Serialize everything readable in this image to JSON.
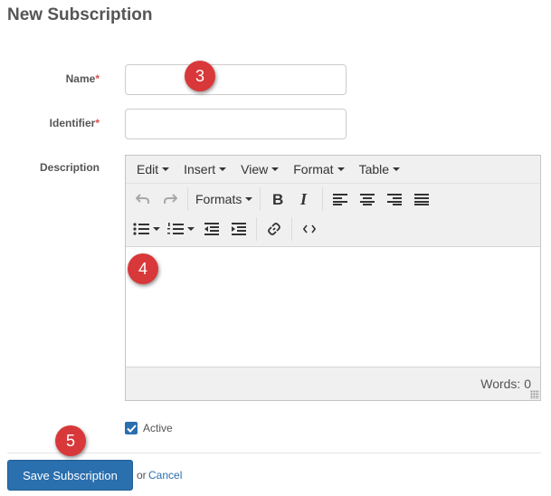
{
  "page": {
    "title": "New Subscription"
  },
  "form": {
    "name": {
      "label": "Name",
      "required_mark": "*",
      "value": ""
    },
    "identifier": {
      "label": "Identifier",
      "required_mark": "*",
      "value": ""
    },
    "description": {
      "label": "Description"
    },
    "active": {
      "label": "Active",
      "checked": true
    }
  },
  "editor": {
    "menus": [
      "Edit",
      "Insert",
      "View",
      "Format",
      "Table"
    ],
    "formats_label": "Formats",
    "status": "Words: 0"
  },
  "badges": [
    "3",
    "4",
    "5"
  ],
  "actions": {
    "save_label": "Save Subscription",
    "or_text": "or",
    "cancel_label": "Cancel"
  },
  "colors": {
    "primary": "#2a6fae",
    "badge": "#d9383a",
    "required": "#d9534f"
  },
  "icons": {
    "undo": "undo-icon",
    "redo": "redo-icon",
    "bold": "bold-icon",
    "italic": "italic-icon",
    "align_left": "align-left-icon",
    "align_center": "align-center-icon",
    "align_right": "align-right-icon",
    "align_justify": "align-justify-icon",
    "bullet_list": "bullet-list-icon",
    "numbered_list": "numbered-list-icon",
    "outdent": "outdent-icon",
    "indent": "indent-icon",
    "link": "link-icon",
    "code": "source-code-icon",
    "checkbox": "checkmark-icon"
  }
}
